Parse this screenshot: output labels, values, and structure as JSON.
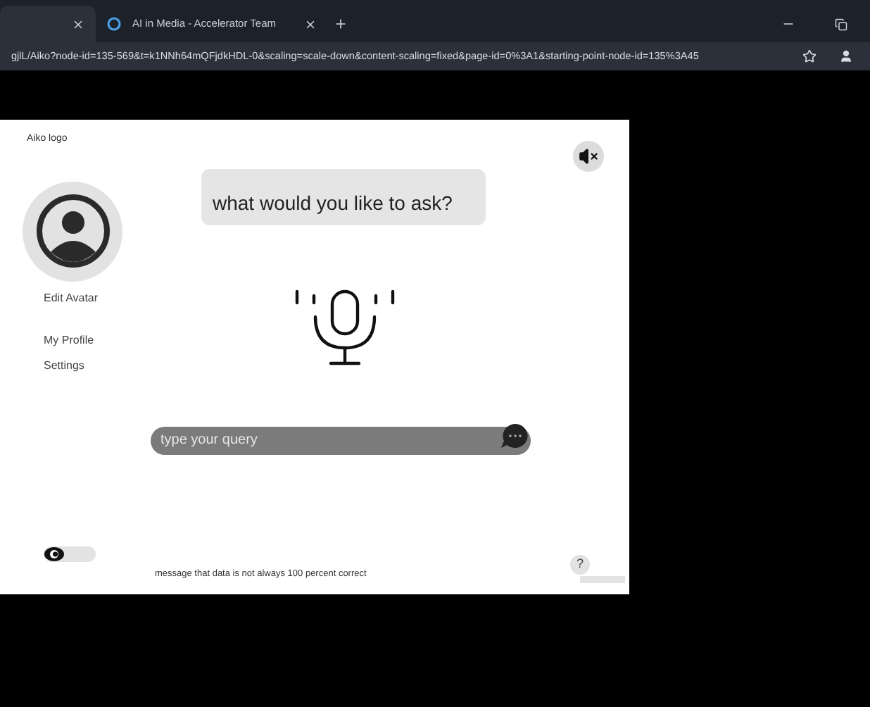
{
  "browser": {
    "tabs": [
      {
        "selected": true
      },
      {
        "title": "AI in Media - Accelerator Team",
        "selected": false
      }
    ],
    "url": "gjlL/Aiko?node-id=135-569&t=k1NNh64mQFjdkHDL-0&scaling=scale-down&content-scaling=fixed&page-id=0%3A1&starting-point-node-id=135%3A45"
  },
  "app": {
    "logo": "Aiko logo",
    "sound_muted": true,
    "avatar_action": "Edit Avatar",
    "menu": [
      {
        "label": "My Profile"
      },
      {
        "label": "Settings"
      }
    ],
    "prompt": "what would you like to ask?",
    "query": {
      "placeholder": "type your query"
    },
    "toggle": {
      "on": false
    },
    "disclaimer": "message that data is not always 100 percent correct",
    "help": "?"
  }
}
